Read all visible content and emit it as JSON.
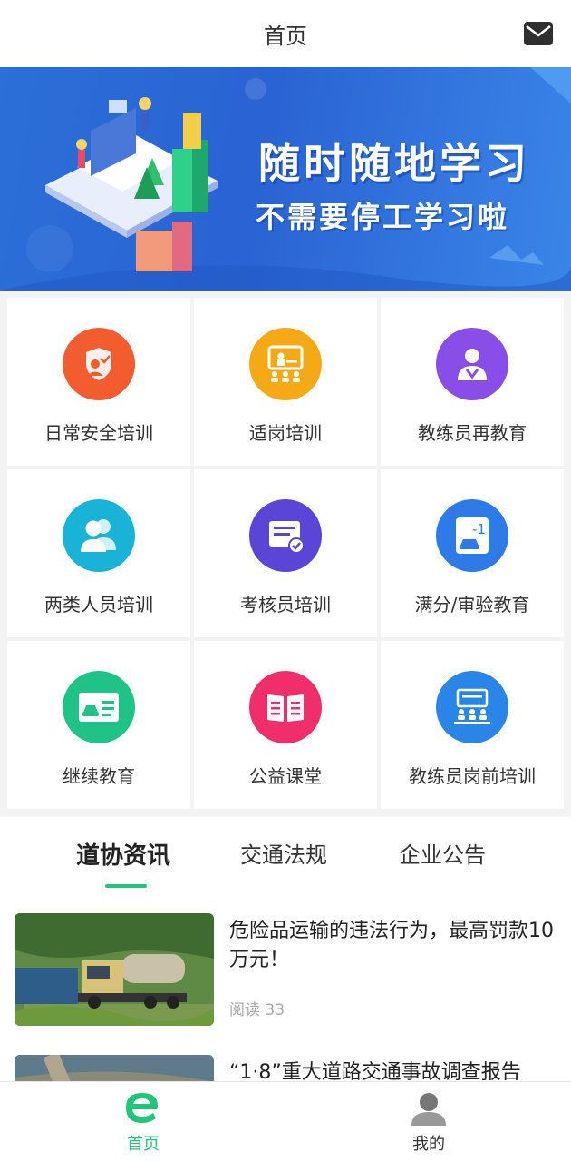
{
  "header": {
    "title": "首页",
    "mail_icon": "mail-icon"
  },
  "banner": {
    "line1": "随时随地学习",
    "line2": "不需要停工学习啦"
  },
  "menu": [
    {
      "label": "日常安全培训",
      "icon": "shield-person-icon",
      "color": "#f25c2e"
    },
    {
      "label": "适岗培训",
      "icon": "presentation-board-icon",
      "color": "#f6a916"
    },
    {
      "label": "教练员再教育",
      "icon": "instructor-icon",
      "color": "#8a4ee8"
    },
    {
      "label": "两类人员培训",
      "icon": "two-people-icon",
      "color": "#1ab3d8"
    },
    {
      "label": "考核员培训",
      "icon": "certificate-check-icon",
      "color": "#5b45d6"
    },
    {
      "label": "满分/审验教育",
      "icon": "car-minus-one-icon",
      "color": "#2e7be8"
    },
    {
      "label": "继续教育",
      "icon": "id-card-icon",
      "color": "#1fc387"
    },
    {
      "label": "公益课堂",
      "icon": "open-book-icon",
      "color": "#ef2e6b"
    },
    {
      "label": "教练员岗前培训",
      "icon": "classroom-icon",
      "color": "#2a86e6"
    }
  ],
  "tabs": [
    {
      "label": "道协资讯",
      "active": true
    },
    {
      "label": "交通法规",
      "active": false
    },
    {
      "label": "企业公告",
      "active": false
    }
  ],
  "news": [
    {
      "title": "危险品运输的违法行为，最高罚款10万元！",
      "meta": "阅读 33"
    },
    {
      "title": "“1·8”重大道路交通事故调查报告"
    }
  ],
  "tabbar": [
    {
      "label": "首页",
      "icon": "home-e-icon",
      "active": true,
      "color": "#22c57a"
    },
    {
      "label": "我的",
      "icon": "user-icon",
      "active": false,
      "color": "#333333"
    }
  ]
}
